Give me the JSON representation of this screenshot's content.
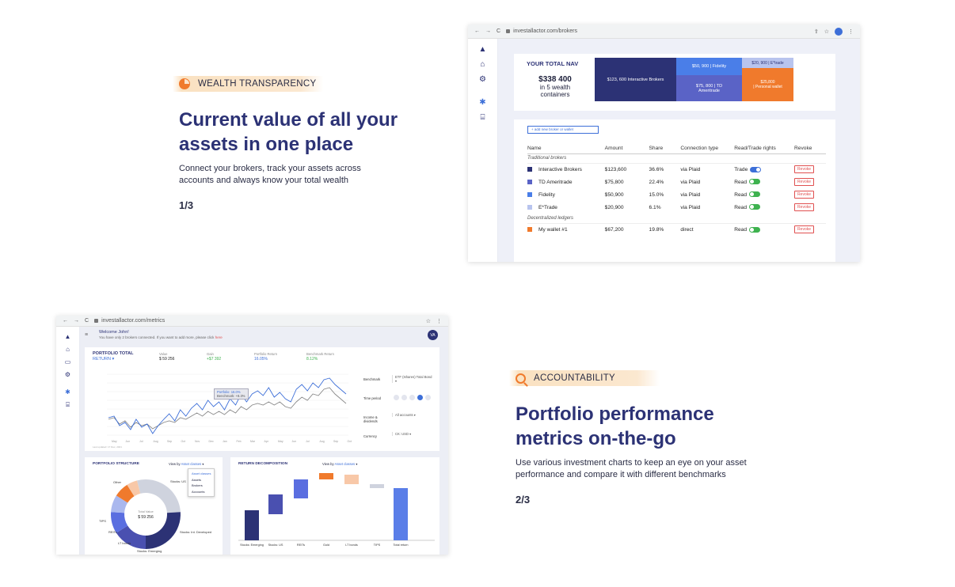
{
  "feature1": {
    "tag": "WEALTH TRANSPARENCY",
    "tag_icon": "pie-chart-icon",
    "title_line1": "Current value of all your",
    "title_line2": "assets in one place",
    "desc_line1": "Connect your brokers, track your assets across",
    "desc_line2": "accounts and always know your total wealth",
    "step": "1/3"
  },
  "feature2": {
    "tag": "ACCOUNTABILITY",
    "tag_icon": "magnifier-icon",
    "title_line1": "Portfolio performance",
    "title_line2": "metrics on-the-go",
    "desc_line1": "Use various investment charts to keep an eye on your asset",
    "desc_line2": "performance and compare it with different benchmarks",
    "step": "2/3"
  },
  "brokers": {
    "url": "investallactor.com/brokers",
    "nav_title": "YOUR TOTAL NAV",
    "nav_total": "$338 400",
    "nav_sub1": "in 5 wealth",
    "nav_sub2": "containers",
    "blocks": {
      "ib": "$123, 600 Interactive Brokers",
      "fid": "$50, 900 | Fidelity",
      "td1": "$75, 800 | TD",
      "td2": "Ameritrade",
      "et": "$20, 900 | E*trade",
      "pw1": "$25,800",
      "pw2": "| Personal wallet"
    },
    "add_label": "+ add new broker or wallet",
    "columns": [
      "Name",
      "Amount",
      "Share",
      "Connection type",
      "Read/Trade rights",
      "Revoke"
    ],
    "section1": "Traditional brokers",
    "section2": "Decentralized ledgers",
    "rows": [
      {
        "name": "Interactive Brokers",
        "amount": "$123,600",
        "share": "36.6%",
        "conn": "via Plaid",
        "rights": "Trade",
        "color": "#2c3275",
        "toggle": "blue"
      },
      {
        "name": "TD Ameritrade",
        "amount": "$75,800",
        "share": "22.4%",
        "conn": "via Plaid",
        "rights": "Read",
        "color": "#5a63c6",
        "toggle": "green"
      },
      {
        "name": "Fidelity",
        "amount": "$50,900",
        "share": "15.0%",
        "conn": "via Plaid",
        "rights": "Read",
        "color": "#4a7ee8",
        "toggle": "green"
      },
      {
        "name": "E*Trade",
        "amount": "$20,900",
        "share": "6.1%",
        "conn": "via Plaid",
        "rights": "Read",
        "color": "#b8c4ee",
        "toggle": "green"
      }
    ],
    "wallet_row": {
      "name": "My wallet #1",
      "amount": "$67,200",
      "share": "19.8%",
      "conn": "direct",
      "rights": "Read",
      "color": "#f07a2c",
      "toggle": "green"
    },
    "revoke_label": "Revoke"
  },
  "metrics": {
    "url": "investallactor.com/metrics",
    "welcome": "Welcome John!",
    "welcome_sub": "You have only 2 brokers connected. If you want to add more, please click",
    "here": "here",
    "avatar": "VA",
    "pt_title": "PORTFOLIO TOTAL",
    "pt_mode": "RETURN",
    "kpis": [
      {
        "label": "Value",
        "value": "$ 59 256"
      },
      {
        "label": "Gain",
        "value": "+$7 392"
      },
      {
        "label": "Portfolio Return",
        "value": "16.05%"
      },
      {
        "label": "Benchmark Return",
        "value": "8.12%"
      }
    ],
    "tooltip1": "Portfolio: 16.0%",
    "tooltip2": "Benchmark: +8.3%",
    "months": [
      "May",
      "Jun",
      "Jul",
      "Aug",
      "Sep",
      "Oct",
      "Nov",
      "Dec",
      "Jan",
      "Feb",
      "Mar",
      "Apr",
      "May",
      "Jun",
      "Jul",
      "Aug",
      "Sep",
      "Oct"
    ],
    "controls": [
      {
        "label": "Benchmark",
        "value": "ETF (Ishares) Total Bond"
      },
      {
        "label": "Time period",
        "value": ""
      },
      {
        "label": "Income & dividends",
        "value": "All accounts"
      },
      {
        "label": "Currency",
        "value": "CK: USD"
      }
    ],
    "structure_title": "PORTFOLIO STRUCTURE",
    "view_by": "View by",
    "view_by_value": "Asset classes",
    "dropdown": [
      "Asset classes",
      "Assets",
      "Brokers",
      "Accounts"
    ],
    "donut_center_label": "Total Value",
    "donut_center_value": "$ 59 256",
    "donut_labels": [
      "Other",
      "Stocks: US",
      "Stocks: Int. Developed",
      "Stocks: Emerging",
      "LT bonds",
      "REITs",
      "TIPS"
    ],
    "decomp_title": "RETURN DECOMPOSITION",
    "decomp_cats": [
      "Stocks: Emerging",
      "Stocks: US",
      "REITs",
      "Gold",
      "LT bonds",
      "TIPS",
      "Total return"
    ],
    "footer_note": "Last updated: 17 Dec, 2021"
  }
}
